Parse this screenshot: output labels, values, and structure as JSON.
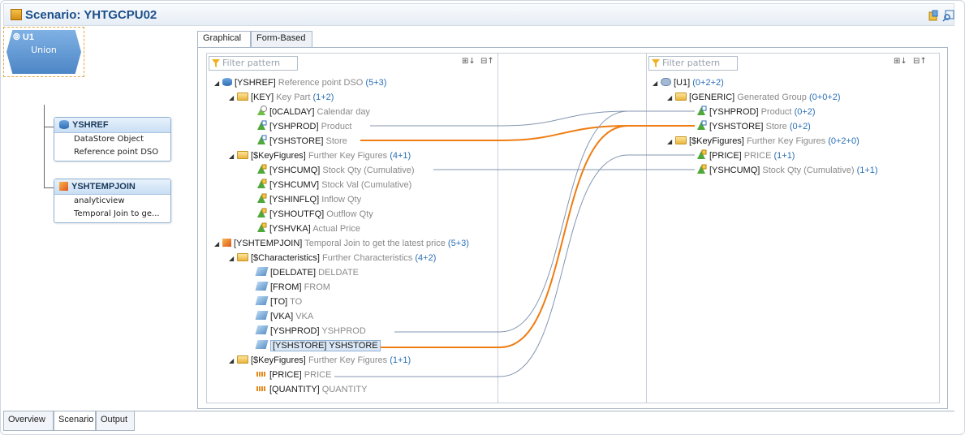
{
  "header": {
    "title": "Scenario: YHTGCPU02"
  },
  "tabs": [
    {
      "label": "Graphical"
    },
    {
      "label": "Form-Based"
    }
  ],
  "union_node": {
    "name": "U1",
    "label": "Union"
  },
  "node_yshref": {
    "name": "YSHREF",
    "line1": "DataStore Object",
    "line2": "Reference point DSO"
  },
  "node_yshtempjoin": {
    "name": "YSHTEMPJOIN",
    "line1": "analyticview",
    "line2": "Temporal Join to ge..."
  },
  "source": {
    "filter_placeholder": "Filter pattern",
    "rows": [
      {
        "key": "[YSHREF]",
        "desc": "Reference point DSO",
        "cnt": "(5+3)"
      },
      {
        "key": "[KEY]",
        "desc": "Key Part",
        "cnt": "(1+2)"
      },
      {
        "key": "[0CALDAY]",
        "desc": "Calendar day",
        "cnt": ""
      },
      {
        "key": "[YSHPROD]",
        "desc": "Product",
        "cnt": ""
      },
      {
        "key": "[YSHSTORE]",
        "desc": "Store",
        "cnt": ""
      },
      {
        "key": "[$KeyFigures]",
        "desc": "Further Key Figures",
        "cnt": "(4+1)"
      },
      {
        "key": "[YSHCUMQ]",
        "desc": "Stock Qty (Cumulative)",
        "cnt": ""
      },
      {
        "key": "[YSHCUMV]",
        "desc": "Stock Val (Cumulative)",
        "cnt": ""
      },
      {
        "key": "[YSHINFLQ]",
        "desc": "Inflow Qty",
        "cnt": ""
      },
      {
        "key": "[YSHOUTFQ]",
        "desc": "Outflow Qty",
        "cnt": ""
      },
      {
        "key": "[YSHVKA]",
        "desc": "Actual Price",
        "cnt": ""
      },
      {
        "key": "[YSHTEMPJOIN]",
        "desc": "Temporal Join to get the latest price",
        "cnt": "(5+3)"
      },
      {
        "key": "[$Characteristics]",
        "desc": "Further Characteristics",
        "cnt": "(4+2)"
      },
      {
        "key": "[DELDATE]",
        "desc": "DELDATE",
        "cnt": ""
      },
      {
        "key": "[FROM]",
        "desc": "FROM",
        "cnt": ""
      },
      {
        "key": "[TO]",
        "desc": "TO",
        "cnt": ""
      },
      {
        "key": "[VKA]",
        "desc": "VKA",
        "cnt": ""
      },
      {
        "key": "[YSHPROD]",
        "desc": "YSHPROD",
        "cnt": ""
      },
      {
        "key": "[YSHSTORE]",
        "desc": "YSHSTORE",
        "cnt": ""
      },
      {
        "key": "[$KeyFigures]",
        "desc": "Further Key Figures",
        "cnt": "(1+1)"
      },
      {
        "key": "[PRICE]",
        "desc": "PRICE",
        "cnt": ""
      },
      {
        "key": "[QUANTITY]",
        "desc": "QUANTITY",
        "cnt": ""
      }
    ]
  },
  "target": {
    "filter_placeholder": "Filter pattern",
    "rows": [
      {
        "key": "[U1]",
        "desc": "",
        "cnt": "(0+2+2)"
      },
      {
        "key": "[GENERIC]",
        "desc": "Generated Group",
        "cnt": "(0+0+2)"
      },
      {
        "key": "[YSHPROD]",
        "desc": "Product",
        "cnt": "(0+2)"
      },
      {
        "key": "[YSHSTORE]",
        "desc": "Store",
        "cnt": "(0+2)"
      },
      {
        "key": "[$KeyFigures]",
        "desc": "Further Key Figures",
        "cnt": "(0+2+0)"
      },
      {
        "key": "[PRICE]",
        "desc": "PRICE",
        "cnt": "(1+1)"
      },
      {
        "key": "[YSHCUMQ]",
        "desc": "Stock Qty (Cumulative)",
        "cnt": "(1+1)"
      }
    ]
  },
  "bottom_tabs": [
    {
      "label": "Overview"
    },
    {
      "label": "Scenario"
    },
    {
      "label": "Output"
    }
  ],
  "colors": {
    "mapping_line": "#8496b0",
    "highlight_line": "#ef7d12",
    "count": "#2a6fb6"
  }
}
